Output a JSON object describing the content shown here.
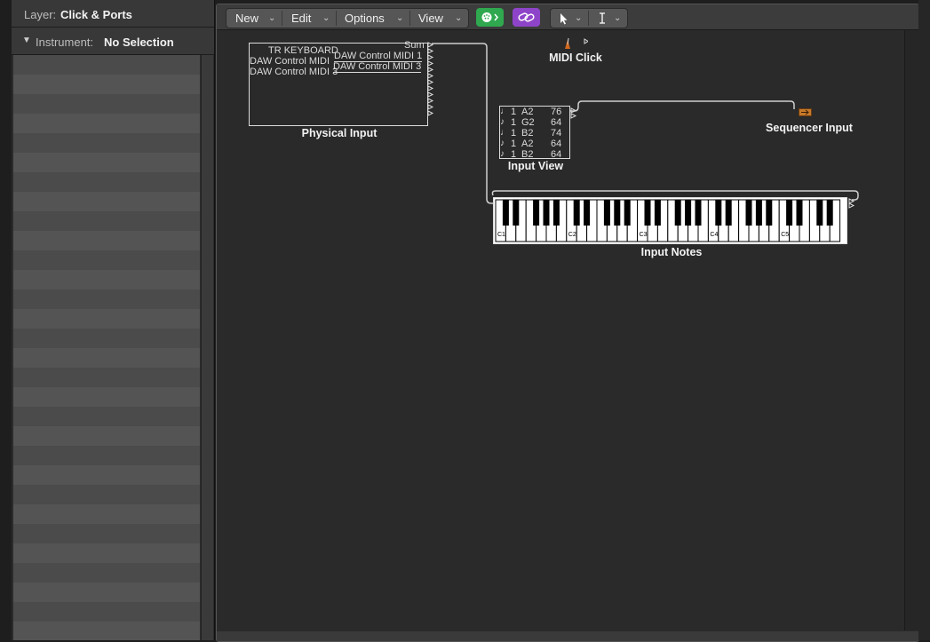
{
  "inspector": {
    "layer_label": "Layer:",
    "layer_value": "Click & Ports",
    "instrument_label": "Instrument:",
    "instrument_value": "No Selection"
  },
  "toolbar": {
    "menus": [
      "New",
      "Edit",
      "Options",
      "View"
    ]
  },
  "physical_input": {
    "lines": [
      "TR KEYBOARD",
      "DAW Control MIDI",
      "DAW Control MIDI 3"
    ],
    "ports": [
      "Sum",
      "DAW Control MIDI 1",
      "DAW Control MIDI 3"
    ],
    "label": "Physical Input"
  },
  "midi_click": {
    "label": "MIDI Click"
  },
  "input_view": {
    "rows": [
      {
        "ch": "1",
        "note": "A2",
        "vel": "76"
      },
      {
        "ch": "1",
        "note": "G2",
        "vel": "64"
      },
      {
        "ch": "1",
        "note": "B2",
        "vel": "74"
      },
      {
        "ch": "1",
        "note": "A2",
        "vel": "64"
      },
      {
        "ch": "1",
        "note": "B2",
        "vel": "64"
      }
    ],
    "label": "Input View"
  },
  "sequencer_input": {
    "label": "Sequencer Input"
  },
  "input_notes": {
    "label": "Input Notes",
    "octave_labels": [
      "C1",
      "C2",
      "C3",
      "C4",
      "C5"
    ]
  },
  "colors": {
    "accent_green": "#2fa84f",
    "accent_purple": "#8e44c9"
  }
}
